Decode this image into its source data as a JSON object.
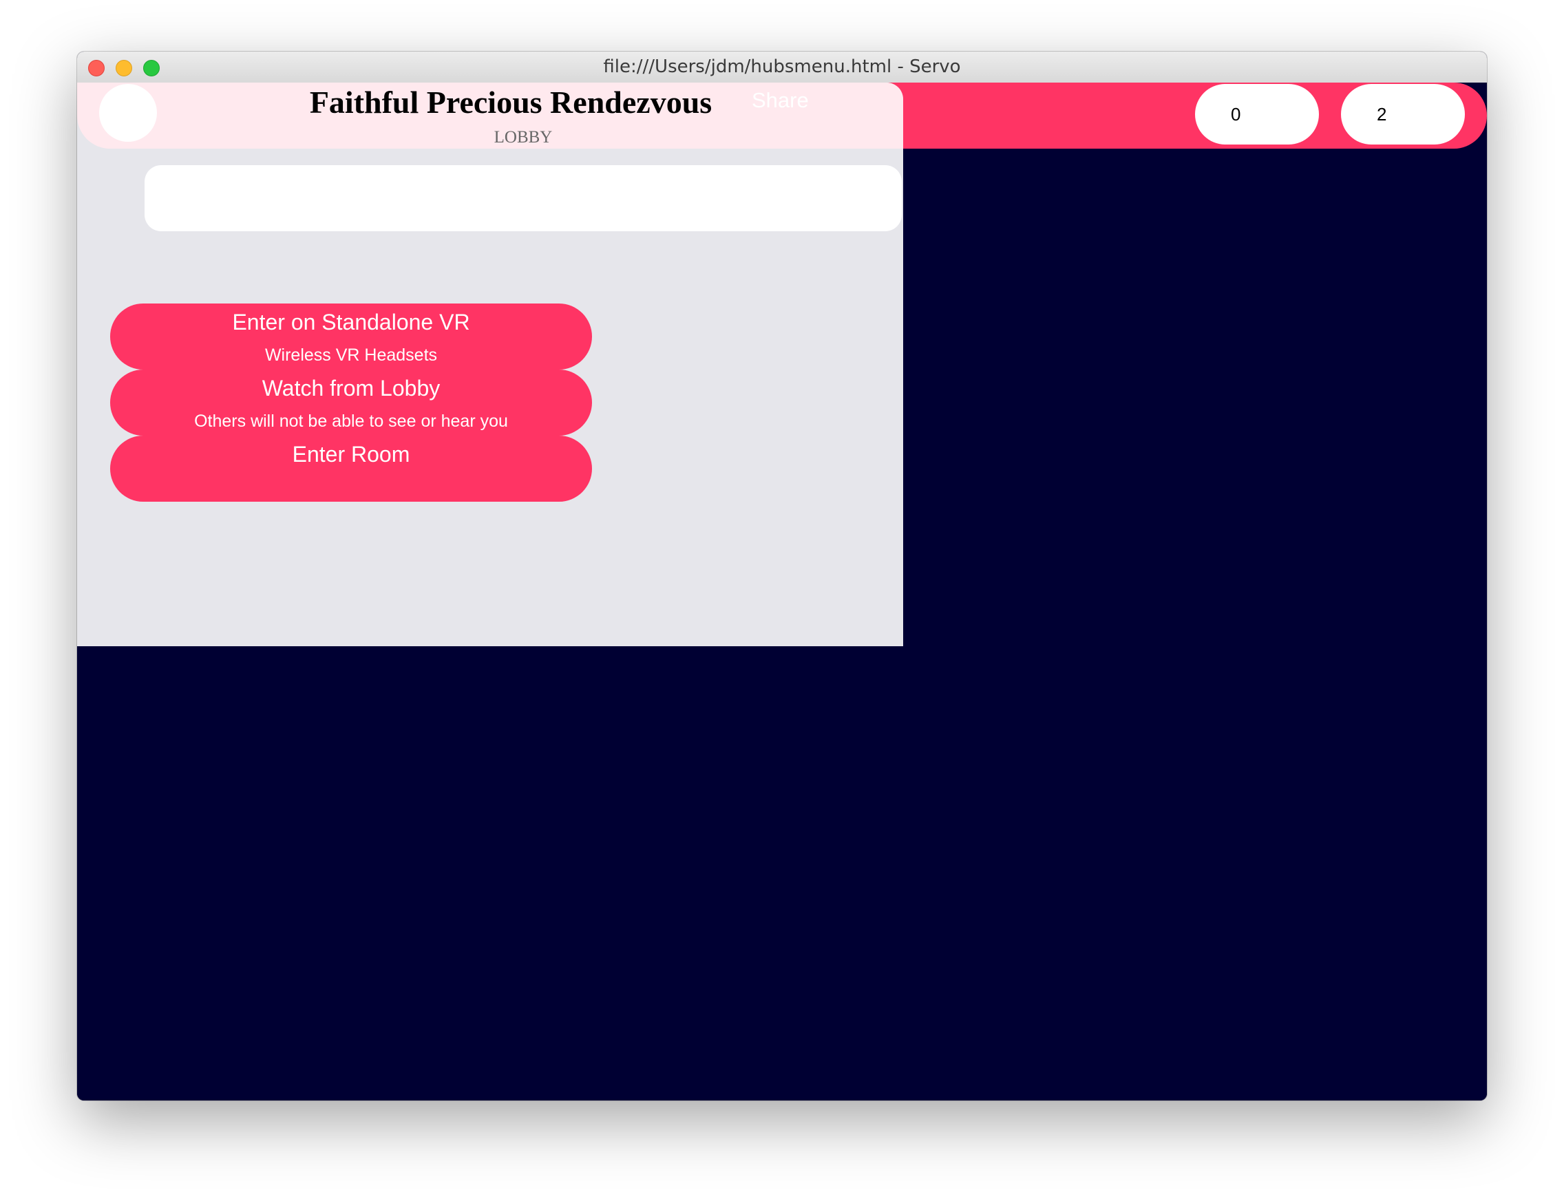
{
  "window": {
    "title": "file:///Users/jdm/hubsmenu.html - Servo"
  },
  "room": {
    "name": "Faithful Precious Rendezvous",
    "subtitle": "LOBBY",
    "share_label": "Share"
  },
  "counters": {
    "first": "0",
    "second": "2"
  },
  "name_field": {
    "value": ""
  },
  "entry_options": [
    {
      "label": "Enter on Standalone VR",
      "description": "Wireless VR Headsets"
    },
    {
      "label": "Watch from Lobby",
      "description": "Others will not be able to see or hear you"
    },
    {
      "label": "Enter Room",
      "description": ""
    }
  ],
  "colors": {
    "accent": "#ff3464",
    "background": "#000033",
    "panel": "#e6e6eb",
    "panel_header": "#ffe9ee"
  }
}
